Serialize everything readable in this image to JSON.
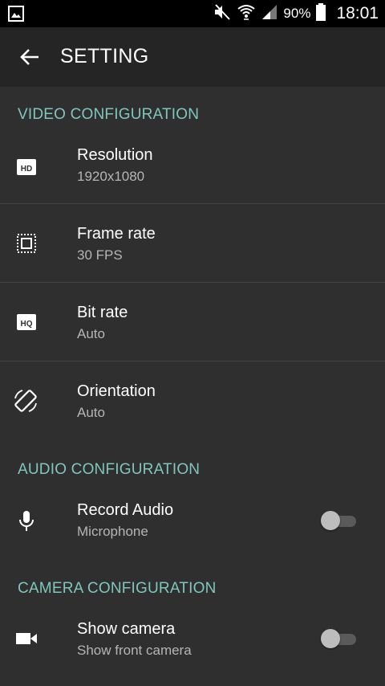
{
  "status_bar": {
    "icons": [
      "gallery-icon",
      "mute-icon",
      "wifi-icon",
      "signal-icon",
      "battery-icon"
    ],
    "battery": "90%",
    "time": "18:01"
  },
  "toolbar": {
    "back_icon": "arrow-back-icon",
    "title": "SETTING"
  },
  "sections": {
    "video": {
      "header": "VIDEO CONFIGURATION",
      "items": [
        {
          "icon": "hd-icon",
          "title": "Resolution",
          "value": "1920x1080"
        },
        {
          "icon": "frame-icon",
          "title": "Frame rate",
          "value": "30 FPS"
        },
        {
          "icon": "hq-icon",
          "title": "Bit rate",
          "value": "Auto"
        },
        {
          "icon": "screen-rotation-icon",
          "title": "Orientation",
          "value": "Auto"
        }
      ]
    },
    "audio": {
      "header": "AUDIO CONFIGURATION",
      "items": [
        {
          "icon": "mic-icon",
          "title": "Record Audio",
          "value": "Microphone",
          "toggle": "off"
        }
      ]
    },
    "camera": {
      "header": "CAMERA CONFIGURATION",
      "items": [
        {
          "icon": "videocam-icon",
          "title": "Show camera",
          "value": "Show front camera",
          "toggle": "off"
        }
      ]
    }
  },
  "colors": {
    "background": "#2f2f2f",
    "toolbar": "#252525",
    "status_bar": "#000000",
    "section_header": "#7fc6be",
    "secondary_text": "#b5b5b5"
  }
}
